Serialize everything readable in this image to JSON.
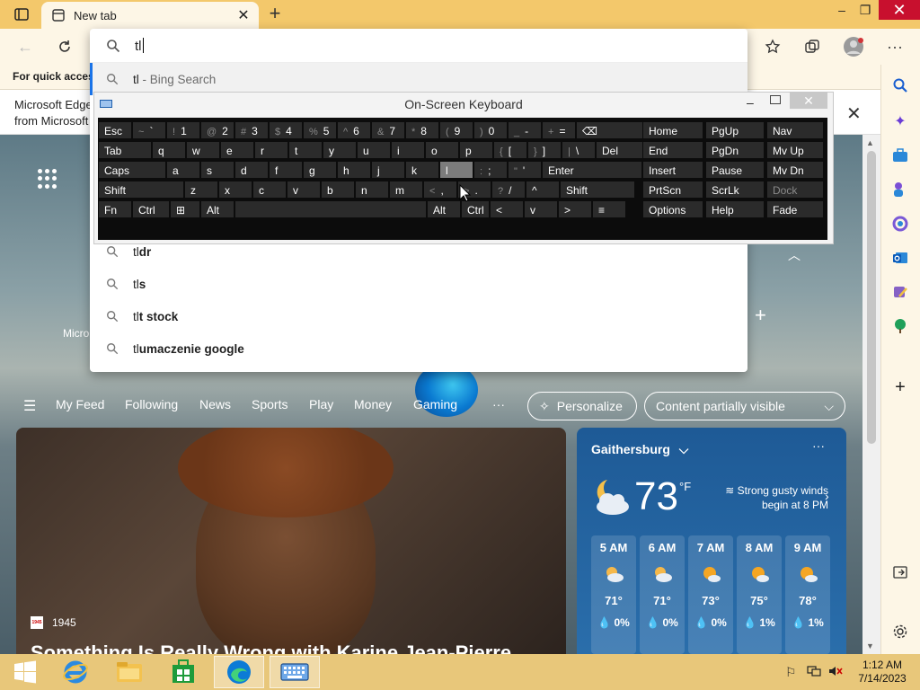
{
  "browser": {
    "tab_title": "New tab",
    "address_value": "tl",
    "favorites_hint": "For quick access",
    "infobar_line1": "Microsoft Edge",
    "infobar_line2": "from Microsoft",
    "accent": "#f3c86b"
  },
  "search": {
    "suggestions": [
      {
        "prefix": "tl",
        "rest": " - Bing Search",
        "kind": "web"
      },
      {
        "prefix": "tl",
        "rest": "dr",
        "kind": "query"
      },
      {
        "prefix": "tl",
        "rest": "s",
        "kind": "query"
      },
      {
        "prefix": "tl",
        "rest": "t stock",
        "kind": "query"
      },
      {
        "prefix": "tl",
        "rest": "umaczenie google",
        "kind": "query"
      }
    ]
  },
  "osk": {
    "title": "On-Screen Keyboard",
    "rows": [
      [
        [
          "Esc",
          ""
        ],
        [
          "`",
          "~"
        ],
        [
          "1",
          "!"
        ],
        [
          "2",
          "@"
        ],
        [
          "3",
          "#"
        ],
        [
          "4",
          "$"
        ],
        [
          "5",
          "%"
        ],
        [
          "6",
          "^"
        ],
        [
          "7",
          "&"
        ],
        [
          "8",
          "*"
        ],
        [
          "9",
          "("
        ],
        [
          "0",
          ")"
        ],
        [
          "-",
          "_"
        ],
        [
          "=",
          "+"
        ],
        [
          "⌫",
          ""
        ]
      ],
      [
        [
          "Tab",
          ""
        ],
        [
          "q",
          ""
        ],
        [
          "w",
          ""
        ],
        [
          "e",
          ""
        ],
        [
          "r",
          ""
        ],
        [
          "t",
          ""
        ],
        [
          "y",
          ""
        ],
        [
          "u",
          ""
        ],
        [
          "i",
          ""
        ],
        [
          "o",
          ""
        ],
        [
          "p",
          ""
        ],
        [
          "[",
          "{"
        ],
        [
          "]",
          "}"
        ],
        [
          "\\",
          "|"
        ],
        [
          "Del",
          ""
        ]
      ],
      [
        [
          "Caps",
          ""
        ],
        [
          "a",
          ""
        ],
        [
          "s",
          ""
        ],
        [
          "d",
          ""
        ],
        [
          "f",
          ""
        ],
        [
          "g",
          ""
        ],
        [
          "h",
          ""
        ],
        [
          "j",
          ""
        ],
        [
          "k",
          ""
        ],
        [
          "l",
          ""
        ],
        [
          ";",
          ":"
        ],
        [
          "'",
          "\""
        ],
        [
          "Enter",
          ""
        ]
      ],
      [
        [
          "Shift",
          ""
        ],
        [
          "z",
          ""
        ],
        [
          "x",
          ""
        ],
        [
          "c",
          ""
        ],
        [
          "v",
          ""
        ],
        [
          "b",
          ""
        ],
        [
          "n",
          ""
        ],
        [
          "m",
          ""
        ],
        [
          ",",
          "<"
        ],
        [
          ".",
          ">"
        ],
        [
          "/",
          "?"
        ],
        [
          "^",
          ""
        ],
        [
          "Shift",
          ""
        ]
      ],
      [
        [
          "Fn",
          ""
        ],
        [
          "Ctrl",
          ""
        ],
        [
          "⊞",
          ""
        ],
        [
          "Alt",
          ""
        ],
        [
          "",
          ""
        ],
        [
          "Alt",
          ""
        ],
        [
          "Ctrl",
          ""
        ],
        [
          "<",
          ""
        ],
        [
          "v",
          ""
        ],
        [
          ">",
          ""
        ],
        [
          "≡",
          ""
        ]
      ]
    ],
    "nav_keys": [
      [
        "Home",
        "PgUp",
        "Nav"
      ],
      [
        "End",
        "PgDn",
        "Mv Up"
      ],
      [
        "Insert",
        "Pause",
        "Mv Dn"
      ],
      [
        "PrtScn",
        "ScrLk",
        "Dock"
      ],
      [
        "Options",
        "Help",
        "Fade"
      ]
    ]
  },
  "feed": {
    "tabs": [
      "My Feed",
      "Following",
      "News",
      "Sports",
      "Play",
      "Money",
      "Gaming"
    ],
    "more": "···",
    "personalize": "Personalize",
    "content_visibility": "Content partially visible",
    "micro_label": "Micro"
  },
  "news": {
    "source": "1945",
    "source_badge": "1945",
    "headline": "Something Is Really Wrong with Karine Jean-Pierre"
  },
  "weather": {
    "city": "Gaithersburg",
    "temp": "73",
    "unit": "°F",
    "alert": "Strong gusty winds begin at 8 PM",
    "hours": [
      {
        "time": "5 AM",
        "temp": "71°",
        "precip": "0%"
      },
      {
        "time": "6 AM",
        "temp": "71°",
        "precip": "0%"
      },
      {
        "time": "7 AM",
        "temp": "73°",
        "precip": "0%"
      },
      {
        "time": "8 AM",
        "temp": "75°",
        "precip": "1%"
      },
      {
        "time": "9 AM",
        "temp": "78°",
        "precip": "1%"
      }
    ]
  },
  "taskbar": {
    "time": "1:12 AM",
    "date": "7/14/2023"
  }
}
